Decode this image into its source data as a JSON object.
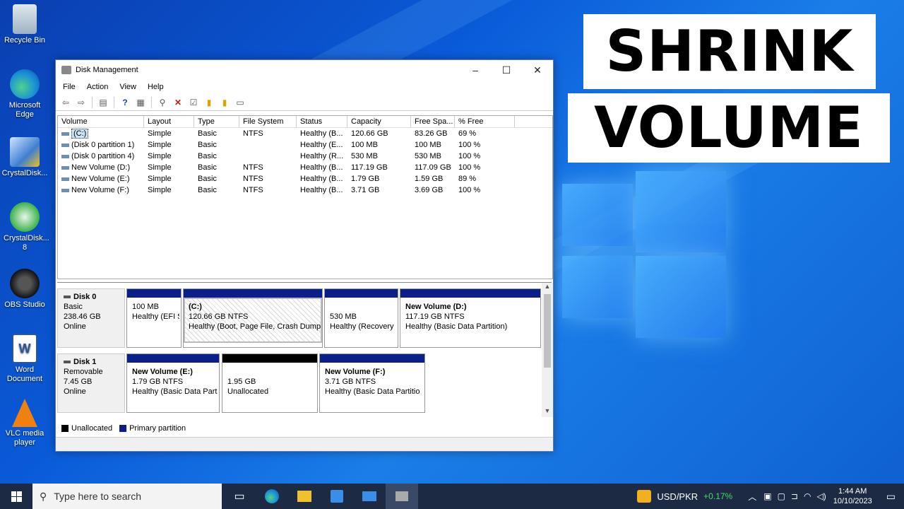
{
  "desktop_icons": [
    {
      "label": "Recycle Bin",
      "icon": "recycle-bin-icon"
    },
    {
      "label": "Microsoft Edge",
      "icon": "edge-icon"
    },
    {
      "label": "CrystalDisk...",
      "icon": "crystaldiskinfo-icon"
    },
    {
      "label": "CrystalDisk... 8",
      "icon": "crystaldiskmark-icon"
    },
    {
      "label": "OBS Studio",
      "icon": "obs-icon"
    },
    {
      "label": "Word Document",
      "icon": "word-icon"
    },
    {
      "label": "VLC media player",
      "icon": "vlc-icon"
    }
  ],
  "overlay": {
    "line1": "SHRINK",
    "line2": "VOLUME"
  },
  "window": {
    "title": "Disk Management",
    "menu": [
      "File",
      "Action",
      "View",
      "Help"
    ],
    "columns": [
      "Volume",
      "Layout",
      "Type",
      "File System",
      "Status",
      "Capacity",
      "Free Spa...",
      "% Free"
    ],
    "rows": [
      [
        "(C:)",
        "Simple",
        "Basic",
        "NTFS",
        "Healthy (B...",
        "120.66 GB",
        "83.26 GB",
        "69 %"
      ],
      [
        "(Disk 0 partition 1)",
        "Simple",
        "Basic",
        "",
        "Healthy (E...",
        "100 MB",
        "100 MB",
        "100 %"
      ],
      [
        "(Disk 0 partition 4)",
        "Simple",
        "Basic",
        "",
        "Healthy (R...",
        "530 MB",
        "530 MB",
        "100 %"
      ],
      [
        "New Volume (D:)",
        "Simple",
        "Basic",
        "NTFS",
        "Healthy (B...",
        "117.19 GB",
        "117.09 GB",
        "100 %"
      ],
      [
        "New Volume (E:)",
        "Simple",
        "Basic",
        "NTFS",
        "Healthy (B...",
        "1.79 GB",
        "1.59 GB",
        "89 %"
      ],
      [
        "New Volume (F:)",
        "Simple",
        "Basic",
        "NTFS",
        "Healthy (B...",
        "3.71 GB",
        "3.69 GB",
        "100 %"
      ]
    ],
    "disk0": {
      "name": "Disk 0",
      "type": "Basic",
      "size": "238.46 GB",
      "state": "Online"
    },
    "disk1": {
      "name": "Disk 1",
      "type": "Removable",
      "size": "7.45 GB",
      "state": "Online"
    },
    "d0parts": [
      {
        "title": "",
        "size": "100 MB",
        "status": "Healthy (EFI S"
      },
      {
        "title": "(C:)",
        "size": "120.66 GB NTFS",
        "status": "Healthy (Boot, Page File, Crash Dump"
      },
      {
        "title": "",
        "size": "530 MB",
        "status": "Healthy (Recovery"
      },
      {
        "title": "New Volume (D:)",
        "size": "117.19 GB NTFS",
        "status": "Healthy (Basic Data Partition)"
      }
    ],
    "d1parts": [
      {
        "title": "New Volume (E:)",
        "size": "1.79 GB NTFS",
        "status": "Healthy (Basic Data Parti"
      },
      {
        "title": "",
        "size": "1.95 GB",
        "status": "Unallocated"
      },
      {
        "title": "New Volume (F:)",
        "size": "3.71 GB NTFS",
        "status": "Healthy (Basic Data Partitio"
      }
    ],
    "legend": {
      "unallocated": "Unallocated",
      "primary": "Primary partition"
    }
  },
  "taskbar": {
    "search_placeholder": "Type here to search",
    "currency": "USD/PKR",
    "change": "+0.17%",
    "time": "1:44 AM",
    "date": "10/10/2023"
  },
  "colors": {
    "primary_partition": "#0a1e8c",
    "unallocated": "#000000",
    "change_green": "#4cd964"
  }
}
